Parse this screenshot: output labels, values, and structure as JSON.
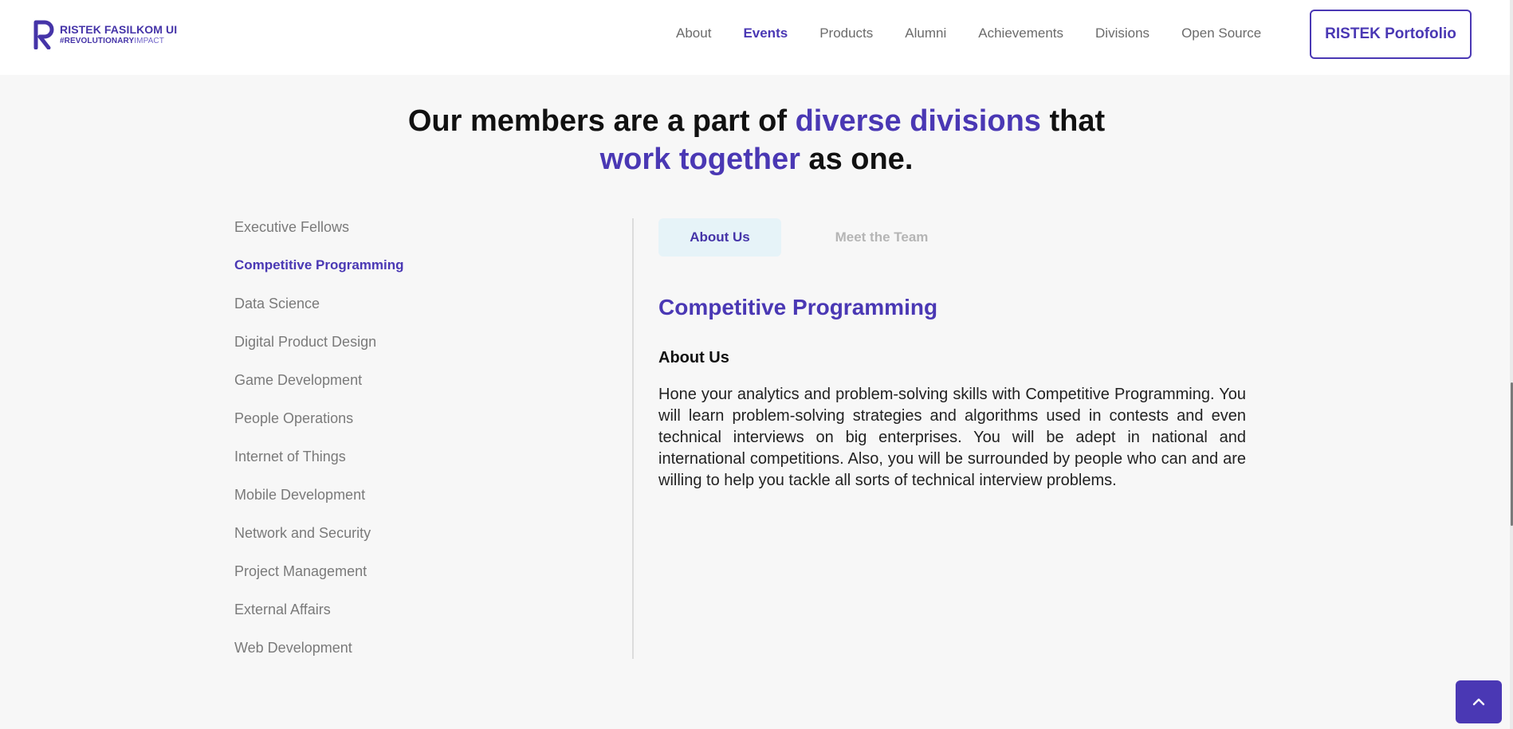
{
  "brand": {
    "title": "RISTEK FASILKOM UI",
    "tagline_bold": "#REVOLUTIONARY",
    "tagline_light": "IMPACT"
  },
  "nav": {
    "items": [
      {
        "label": "About"
      },
      {
        "label": "Events"
      },
      {
        "label": "Products"
      },
      {
        "label": "Alumni"
      },
      {
        "label": "Achievements"
      },
      {
        "label": "Divisions"
      },
      {
        "label": "Open Source"
      }
    ],
    "active": "Events",
    "portfolio_label": "RISTEK Portofolio"
  },
  "heading": {
    "part1": "Our members are a part of ",
    "accent1": "diverse divisions",
    "part2": " that",
    "accent2": "work together",
    "part3": " as one."
  },
  "divisions": {
    "items": [
      {
        "label": "Executive Fellows"
      },
      {
        "label": "Competitive Programming"
      },
      {
        "label": "Data Science"
      },
      {
        "label": "Digital Product Design"
      },
      {
        "label": "Game Development"
      },
      {
        "label": "People Operations"
      },
      {
        "label": "Internet of Things"
      },
      {
        "label": "Mobile Development"
      },
      {
        "label": "Network and Security"
      },
      {
        "label": "Project Management"
      },
      {
        "label": "External Affairs"
      },
      {
        "label": "Web Development"
      }
    ],
    "selected": "Competitive Programming"
  },
  "tabs": {
    "about_label": "About Us",
    "team_label": "Meet the Team"
  },
  "detail": {
    "title": "Competitive Programming",
    "section_heading": "About Us",
    "body": "Hone your analytics and problem-solving skills with Competitive Programming. You will learn problem-solving strategies and algorithms used in contests and even technical interviews on big enterprises. You will be adept in national and international competitions. Also, you will be surrounded by people who can and are willing to help you tackle all sorts of technical interview problems."
  },
  "icons": {
    "logo": "ristek-r-logo",
    "back_to_top": "chevron-up-icon"
  },
  "colors": {
    "accent": "#4a38b4",
    "tab_bg": "#e6f3f8",
    "page_bg": "#f7f7f7"
  }
}
